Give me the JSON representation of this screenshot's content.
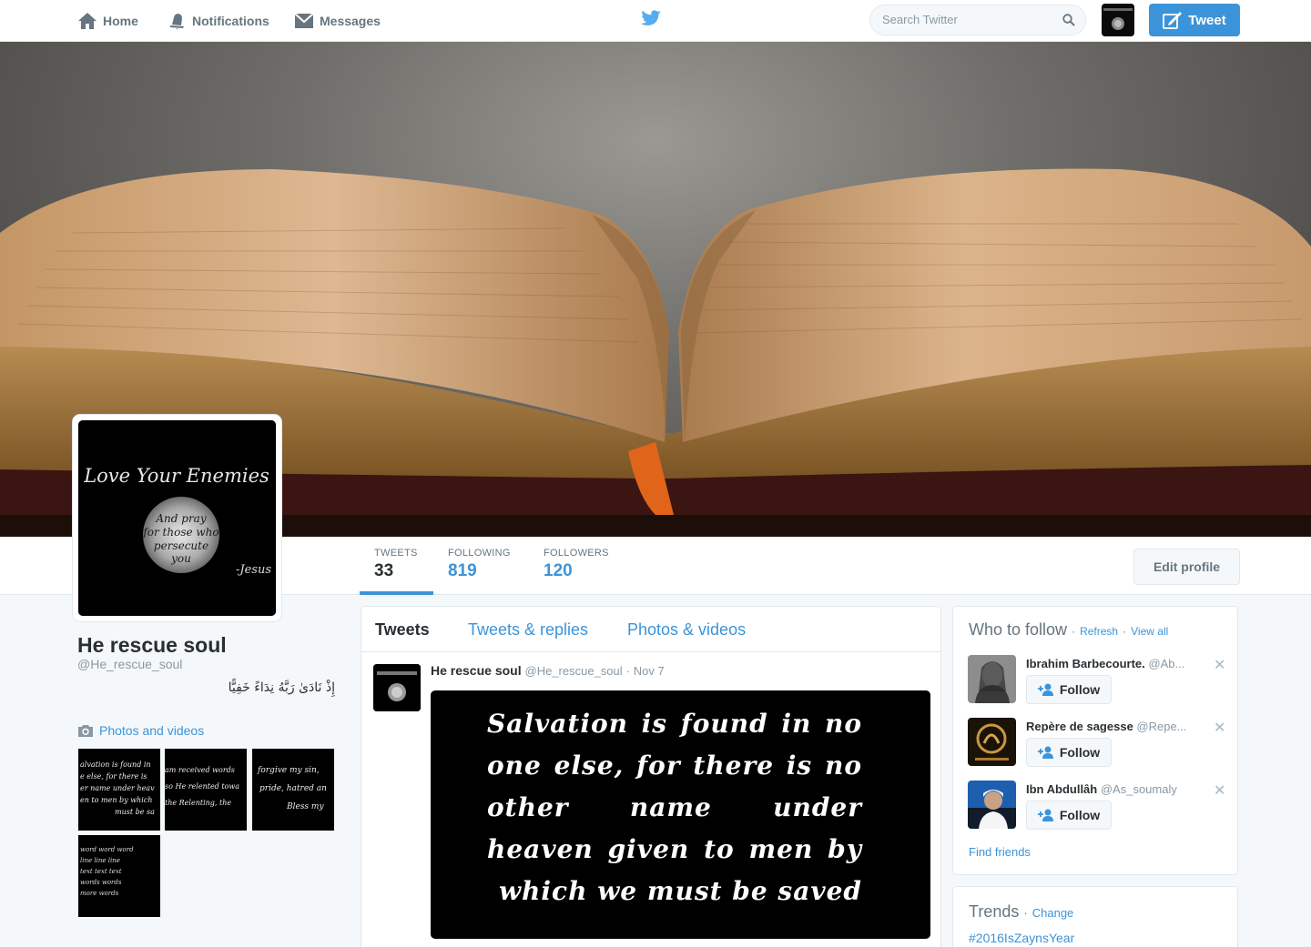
{
  "colors": {
    "accent": "#3b94d9",
    "text": "#292f33",
    "muted": "#66757f",
    "light": "#8899a6",
    "border": "#e1e8ed",
    "background": "#f5f8fa"
  },
  "nav": {
    "home": "Home",
    "notifications": "Notifications",
    "messages": "Messages",
    "search_placeholder": "Search Twitter",
    "tweet_button": "Tweet"
  },
  "profile": {
    "name": "He rescue soul",
    "handle": "@He_rescue_soul",
    "bio": "إِذْ نَادَىٰ رَبَّهُ نِدَاءً خَفِيًّا",
    "avatar_lines": [
      "Love Your Enemies",
      "And pray",
      "for those who",
      "persecute",
      "you",
      "-Jesus"
    ],
    "edit_profile": "Edit profile",
    "photos_videos_link": "Photos and videos"
  },
  "stats": [
    {
      "label": "TWEETS",
      "value": "33"
    },
    {
      "label": "FOLLOWING",
      "value": "819"
    },
    {
      "label": "FOLLOWERS",
      "value": "120"
    }
  ],
  "photo_thumbs": [
    [
      "alvation is found in",
      "e else, for there is",
      "er name under heav",
      "en to men by which",
      "must be sa"
    ],
    [
      "am received words",
      "so He relented towa",
      "the Relenting, the"
    ],
    [
      "forgive my sin,",
      "pride, hatred an",
      "Bless my"
    ],
    [
      "word word word",
      "line line line",
      "text text text",
      "words words",
      "more words"
    ]
  ],
  "timeline": {
    "tabs": [
      "Tweets",
      "Tweets & replies",
      "Photos & videos"
    ],
    "tweet": {
      "name": "He rescue soul",
      "handle": "@He_rescue_soul",
      "sep": "·",
      "time": "Nov 7",
      "media_text": "Salvation is found in no one else, for there is no other name under heaven given to men by which we must be saved"
    }
  },
  "who_to_follow": {
    "title": "Who to follow",
    "sep": "·",
    "refresh": "Refresh",
    "view_all": "View all",
    "follow_label": "Follow",
    "close_glyph": "✕",
    "suggestions": [
      {
        "name": "Ibrahim Barbecourte.",
        "handle": "@Ab..."
      },
      {
        "name": "Repère de sagesse",
        "handle": "@Repe..."
      },
      {
        "name": "Ibn Abdullâh",
        "handle": "@As_soumaly"
      }
    ],
    "find_friends": "Find friends"
  },
  "trends": {
    "title": "Trends",
    "sep": "·",
    "change": "Change",
    "items": [
      "#2016IsZaynsYear"
    ]
  },
  "icons": [
    "home-icon",
    "notifications-icon",
    "messages-icon",
    "twitter-bird-icon",
    "search-icon",
    "compose-icon",
    "camera-icon",
    "add-user-icon",
    "close-icon"
  ]
}
